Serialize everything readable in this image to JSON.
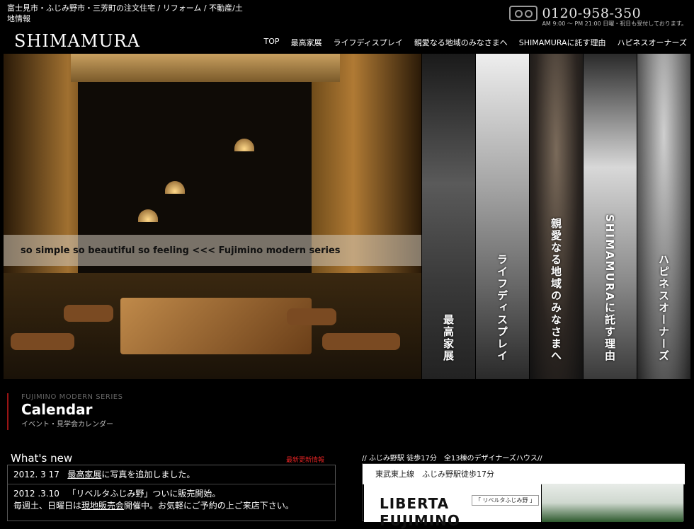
{
  "header": {
    "tagline": "富士見市・ふじみ野市・三芳町の注文住宅 / リフォーム / 不動産/土地情報",
    "phone": "0120-958-350",
    "hours": "AM 9:00 〜 PM 21:00  日曜・祝日も受付しております。",
    "logo": "SHIMAMURA",
    "nav": [
      "TOP",
      "最高家展",
      "ライフディスプレイ",
      "親愛なる地域のみなさまへ",
      "SHIMAMURAに託す理由",
      "ハピネスオーナーズ"
    ]
  },
  "hero": {
    "banner": "so simple so beautiful so feeling   <<<   Fujimino modern series"
  },
  "panels": [
    "最高家展",
    "ライフディスプレイ",
    "親愛なる地域のみなさまへ",
    "SHIMAMURAに託す理由",
    "ハピネスオーナーズ"
  ],
  "calendar": {
    "eyebrow": "FUJIMINO MODERN SERIES",
    "title": "Calendar",
    "subtitle": "イベント・見学会カレンダー"
  },
  "news": {
    "heading": "What's new",
    "more_label": "最新更新情報",
    "items": [
      {
        "date": "2012. 3 17",
        "link": "最高家展",
        "text": "に写真を追加しました。"
      },
      {
        "date": "2012 .3.10",
        "text": "「リベルタふじみ野」ついに販売開始。",
        "line2_pre": "毎週土、日曜日は",
        "line2_link": "現地販売会",
        "line2_post": "開催中。お気軽にご予約の上ご来店下さい。"
      }
    ]
  },
  "ad": {
    "heading": "// ふじみ野駅 徒歩17分　全13棟のデザイナーズハウス//",
    "bar": "東武東上線　ふじみ野駅徒歩17分",
    "title_line1": "LIBERTA",
    "title_line2": "FUJIMINO",
    "tag": "「 リベルタふじみ野 」"
  }
}
